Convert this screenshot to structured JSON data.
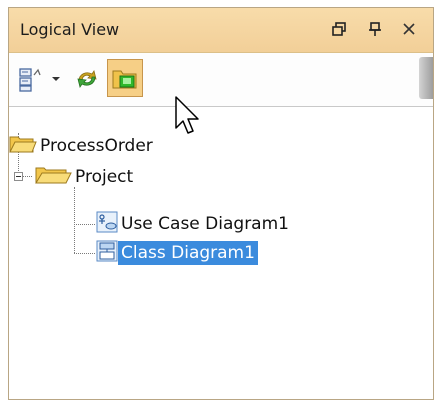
{
  "panel": {
    "title": "Logical View",
    "icons": {
      "restore": "restore-window-icon",
      "pin": "pin-icon",
      "close": "close-icon"
    }
  },
  "toolbar": {
    "buttons": [
      {
        "name": "model-tree-icon",
        "has_dropdown": true
      },
      {
        "name": "refresh-icon"
      },
      {
        "name": "open-folder-icon",
        "pressed": true
      }
    ]
  },
  "tree": {
    "root": {
      "label": "ProcessOrder",
      "icon": "open-folder-icon",
      "children": [
        {
          "label": "Project",
          "icon": "open-folder-icon",
          "expanded": true,
          "children": [
            {
              "label": "Use Case Diagram1",
              "icon": "use-case-diagram-icon",
              "selected": false
            },
            {
              "label": "Class Diagram1",
              "icon": "class-diagram-icon",
              "selected": true
            }
          ]
        }
      ]
    }
  },
  "colors": {
    "titlebar": "#f6d7a2",
    "selection": "#3b8bdd",
    "folder": "#f2c64b"
  }
}
